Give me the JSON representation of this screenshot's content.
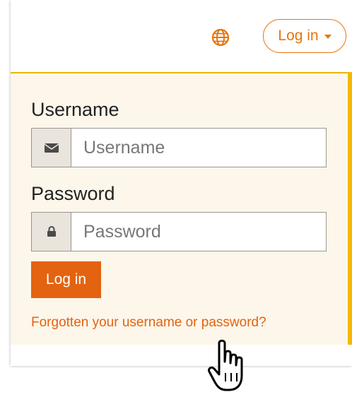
{
  "header": {
    "language_icon": "globe-icon",
    "login_toggle_label": "Log in"
  },
  "login_form": {
    "username_label": "Username",
    "username_placeholder": "Username",
    "username_icon": "envelope-icon",
    "password_label": "Password",
    "password_placeholder": "Password",
    "password_icon": "lock-icon",
    "submit_label": "Log in",
    "forgot_link": "Forgotten your username or password?"
  },
  "colors": {
    "accent": "#e36310",
    "panel_bg": "#fdf6ea",
    "panel_border": "#f0b400"
  },
  "cursor": "hand-pointer-icon"
}
